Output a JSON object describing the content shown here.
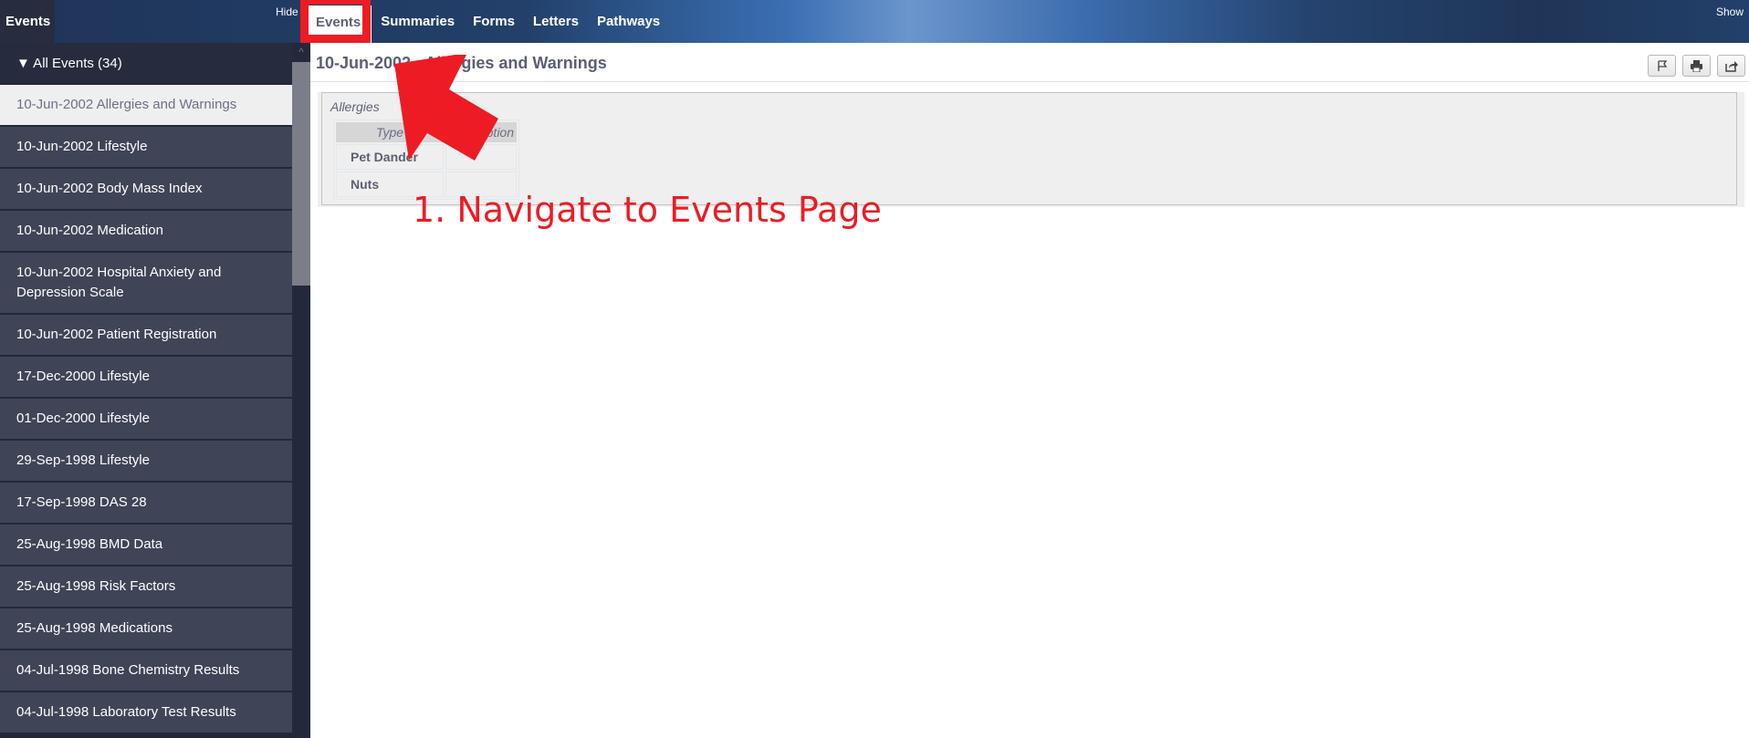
{
  "header": {
    "panel_title": "Events",
    "hide_label": "Hide",
    "show_label": "Show",
    "nav": [
      {
        "label": "Events",
        "active": true
      },
      {
        "label": "Summaries",
        "active": false
      },
      {
        "label": "Forms",
        "active": false
      },
      {
        "label": "Letters",
        "active": false
      },
      {
        "label": "Pathways",
        "active": false
      }
    ]
  },
  "sidebar": {
    "group_label": "▼ All Events (34)",
    "items": [
      {
        "label": "10-Jun-2002 Allergies and Warnings",
        "active": true
      },
      {
        "label": "10-Jun-2002 Lifestyle"
      },
      {
        "label": "10-Jun-2002 Body Mass Index"
      },
      {
        "label": "10-Jun-2002 Medication"
      },
      {
        "label": "10-Jun-2002 Hospital Anxiety and Depression Scale"
      },
      {
        "label": "10-Jun-2002 Patient Registration"
      },
      {
        "label": "17-Dec-2000 Lifestyle"
      },
      {
        "label": "01-Dec-2000 Lifestyle"
      },
      {
        "label": "29-Sep-1998 Lifestyle"
      },
      {
        "label": "17-Sep-1998 DAS 28"
      },
      {
        "label": "25-Aug-1998 BMD Data"
      },
      {
        "label": "25-Aug-1998 Risk Factors"
      },
      {
        "label": "25-Aug-1998 Medications"
      },
      {
        "label": "04-Jul-1998 Bone Chemistry Results"
      },
      {
        "label": "04-Jul-1998 Laboratory Test Results"
      }
    ]
  },
  "main": {
    "title": "10-Jun-2002 - Allergies and Warnings",
    "actions": [
      {
        "name": "flag",
        "icon": "⚐"
      },
      {
        "name": "print",
        "icon": "🖶"
      },
      {
        "name": "share",
        "icon": "⇪"
      }
    ],
    "allergies": {
      "label": "Allergies",
      "columns": [
        "Type",
        "Description"
      ],
      "rows": [
        [
          "Pet Dander",
          ""
        ],
        [
          "Nuts",
          ""
        ]
      ]
    }
  },
  "annotation": {
    "text": "1. Navigate to Events Page",
    "color": "#ed1c24"
  }
}
